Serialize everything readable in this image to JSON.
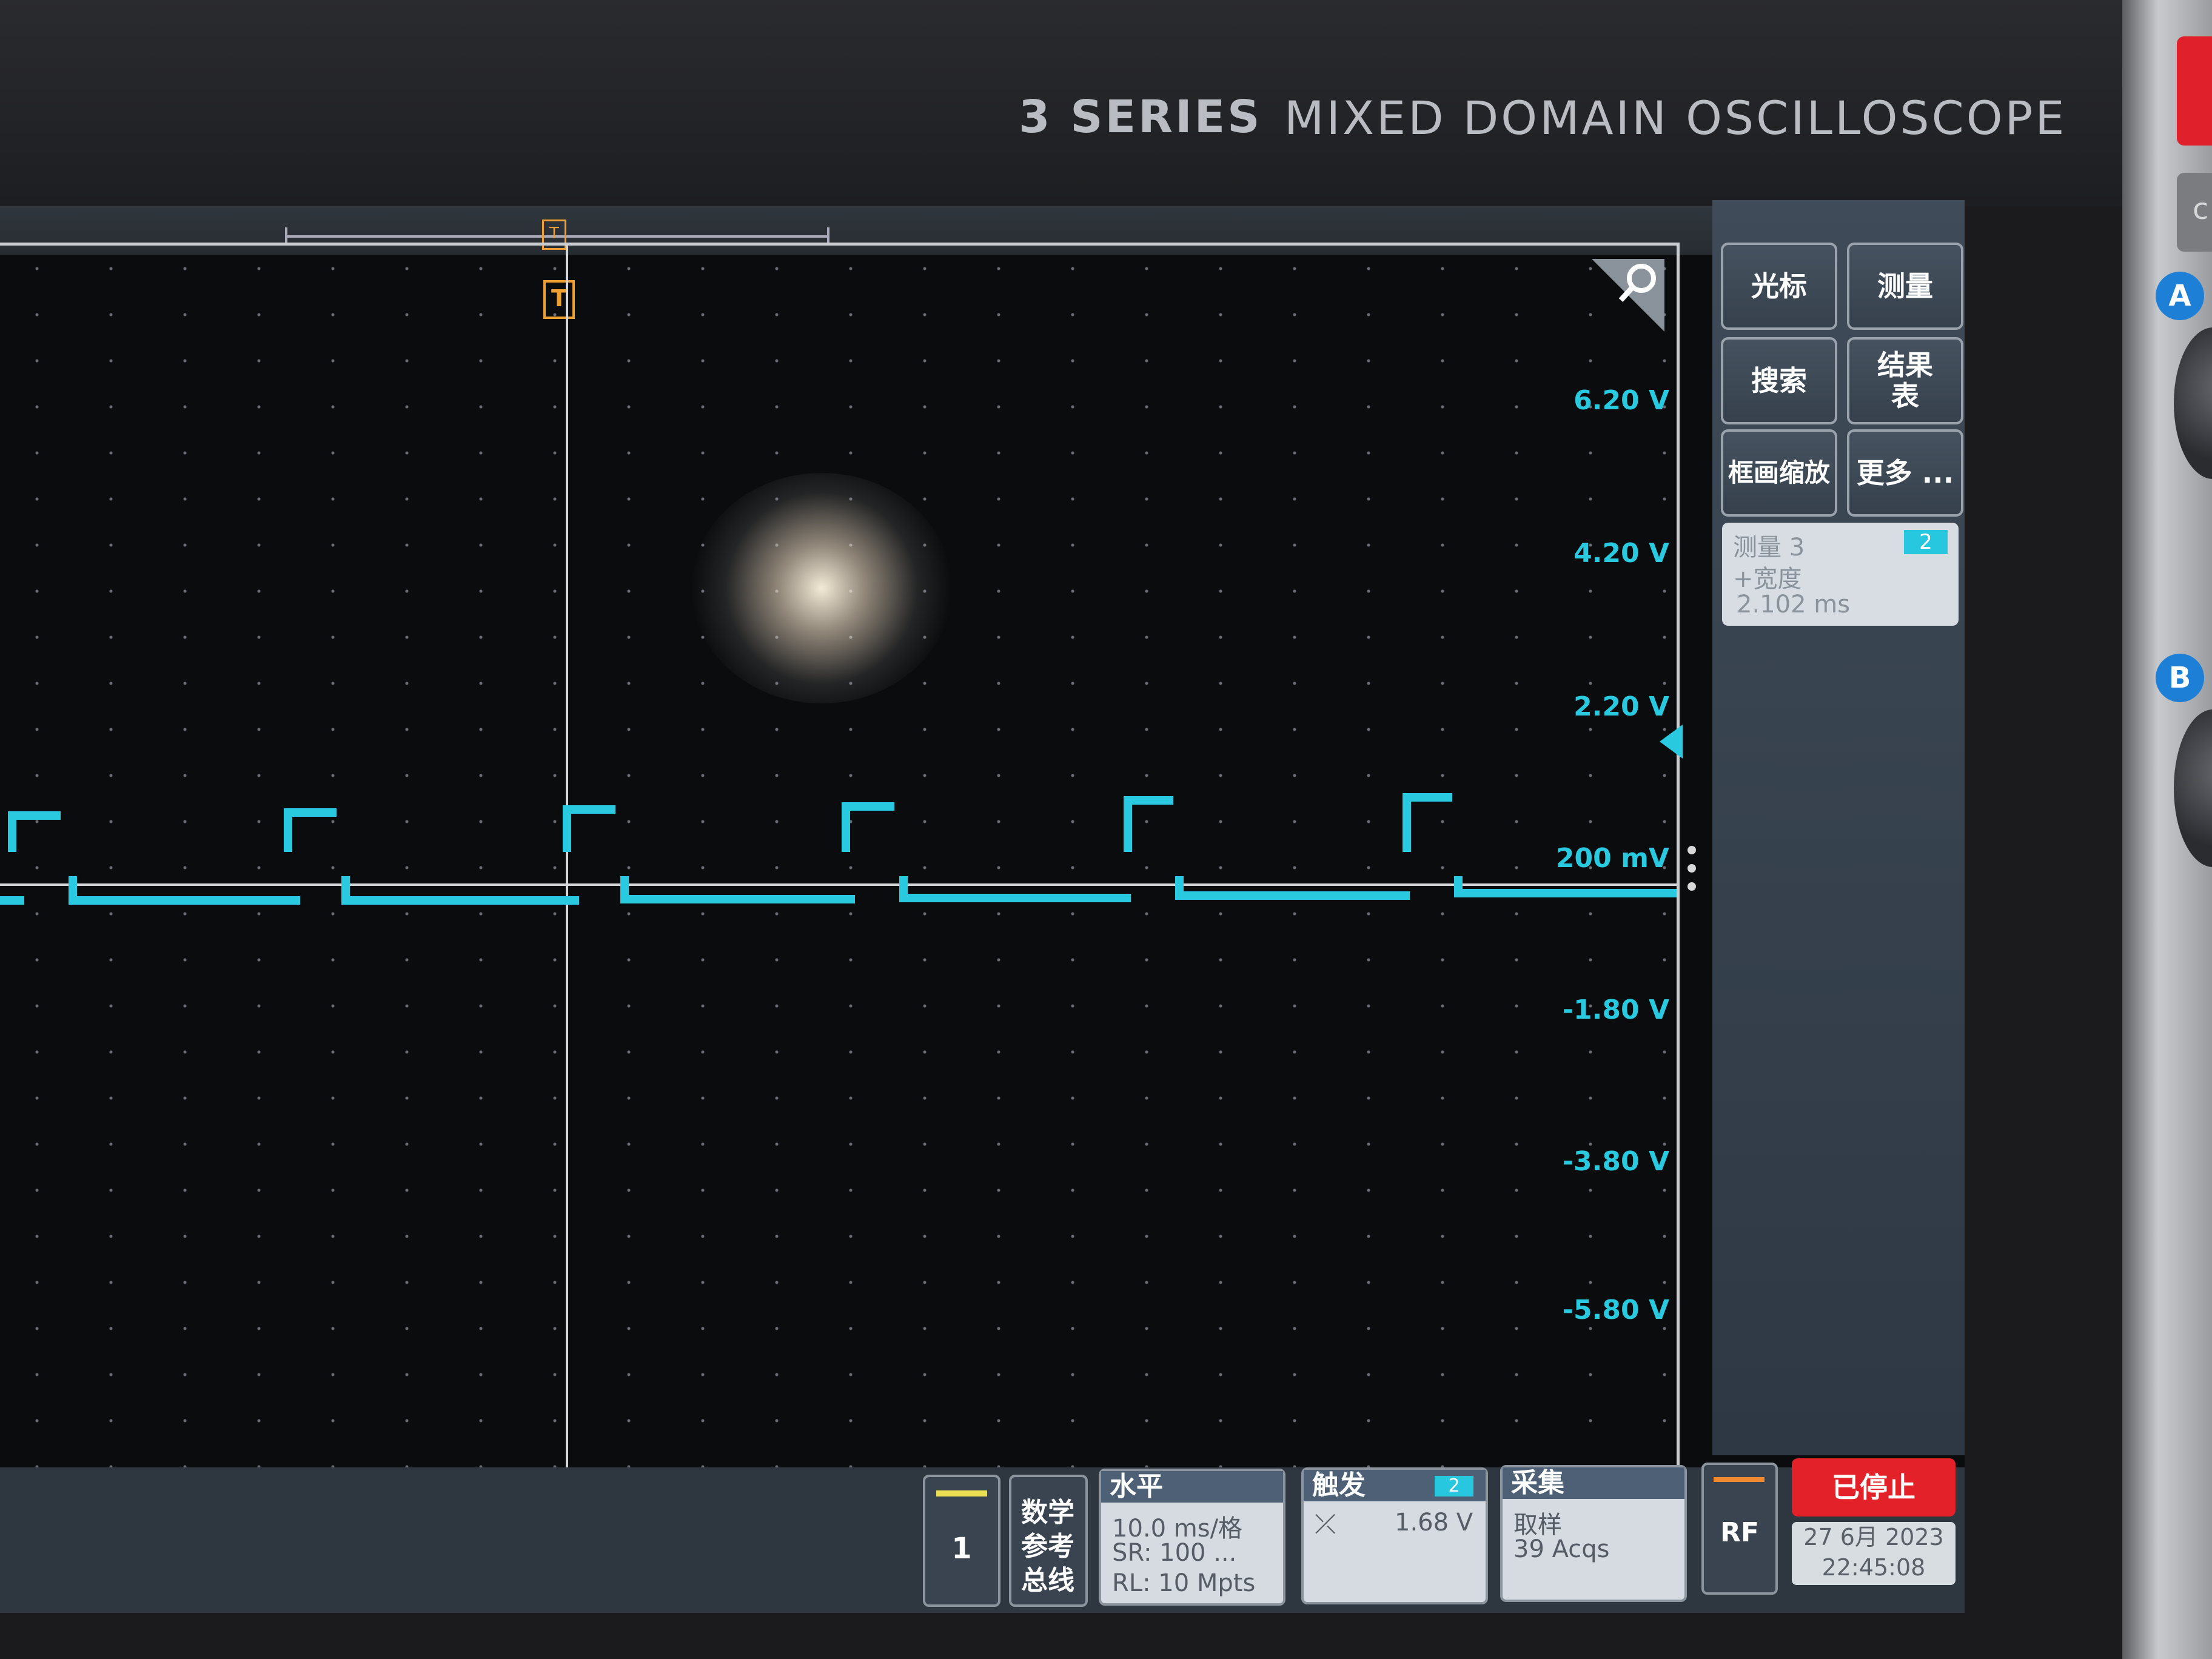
{
  "bezel": {
    "series": "3 SERIES",
    "model": "MIXED DOMAIN OSCILLOSCOPE"
  },
  "trigger_marker": "T",
  "scale_labels": [
    "6.20 V",
    "4.20 V",
    "2.20 V",
    "200 mV",
    "-1.80 V",
    "-3.80 V",
    "-5.80 V"
  ],
  "side_menu": {
    "cursor": "光标",
    "measure": "测量",
    "search": "搜索",
    "results_line1": "结果",
    "results_line2": "表",
    "box_zoom": "框画缩放",
    "more": "更多 ..."
  },
  "measurement": {
    "title": "测量 3",
    "channel": "2",
    "type": "+宽度",
    "value": "2.102 ms"
  },
  "bottom_bar": {
    "channel1": "1",
    "math_ref_bus": [
      "数学",
      "参考",
      "总线"
    ],
    "horizontal": {
      "title": "水平",
      "scale": "10.0 ms/格",
      "sample_rate": "SR: 100 ...",
      "record_length": "RL: 10 Mpts"
    },
    "trigger": {
      "title": "触发",
      "channel": "2",
      "level": "1.68 V"
    },
    "acquisition": {
      "title": "采集",
      "mode": "取样",
      "count": "39 Acqs"
    },
    "rf": "RF",
    "status": "已停止",
    "date": "27 6月 2023",
    "time": "22:45:08"
  },
  "hardware_labels": {
    "knob_a": "A",
    "knob_b": "B",
    "button_c": "c"
  },
  "colors": {
    "trace": "#29c9e0",
    "trigger": "#f0a030",
    "stopped": "#e32128"
  }
}
